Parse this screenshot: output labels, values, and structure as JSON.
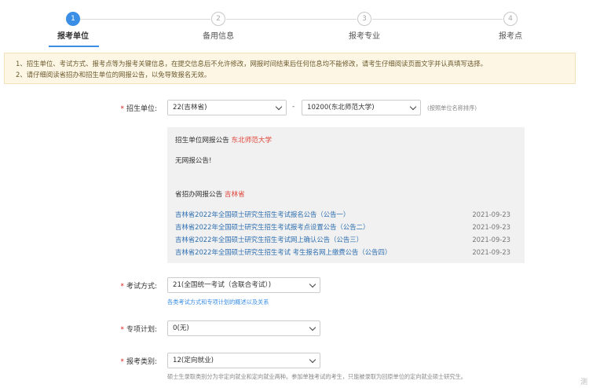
{
  "steps": [
    {
      "num": "1",
      "label": "报考单位",
      "active": true
    },
    {
      "num": "2",
      "label": "备用信息",
      "active": false
    },
    {
      "num": "3",
      "label": "报考专业",
      "active": false
    },
    {
      "num": "4",
      "label": "报考点",
      "active": false
    }
  ],
  "notice": {
    "line1": "1、招生单位、考试方式、报考点等为报考关键信息，在提交信息后不允许修改，网报时间结束后任何信息均不能修改，请考生仔细阅读页面文字并认真填写选择。",
    "line2": "2、请仔细阅读省招办和招生单位的网报公告，以免导致报名无效。"
  },
  "form": {
    "unit": {
      "label": "招生单位:",
      "province": "22(吉林省)",
      "school": "10200(东北师范大学)",
      "note": "(按照单位名称排序)"
    },
    "unit_notice": {
      "title_prefix": "招生单位网报公告",
      "title_name": "东北师范大学",
      "content": "无网报公告!"
    },
    "province_notice": {
      "title_prefix": "省招办网报公告",
      "title_name": "吉林省",
      "items": [
        {
          "title": "吉林省2022年全国硕士研究生招生考试报名公告（公告一）",
          "date": "2021-09-23"
        },
        {
          "title": "吉林省2022年全国硕士研究生招生考试报考点设置公告（公告二）",
          "date": "2021-09-23"
        },
        {
          "title": "吉林省2022年全国硕士研究生招生考试网上确认公告（公告三）",
          "date": "2021-09-23"
        },
        {
          "title": "吉林省2022年全国硕士研究生招生考试 考生报名网上缴费公告（公告四）",
          "date": "2021-09-23"
        }
      ]
    },
    "exam_mode": {
      "label": "考试方式:",
      "value": "21(全国统一考试（含联合考试）)",
      "hint": "各类考试方式和专项计划的概述以及关系"
    },
    "special_plan": {
      "label": "专项计划:",
      "value": "0(无)"
    },
    "category": {
      "label": "报考类别:",
      "value": "12(定向就业)",
      "hint": "硕士生录取类别分为非定向就业和定向就业两种。参加单独考试的考生，只能被录取为回原单位的定向就业硕士研究生。"
    }
  },
  "watermark": "测"
}
